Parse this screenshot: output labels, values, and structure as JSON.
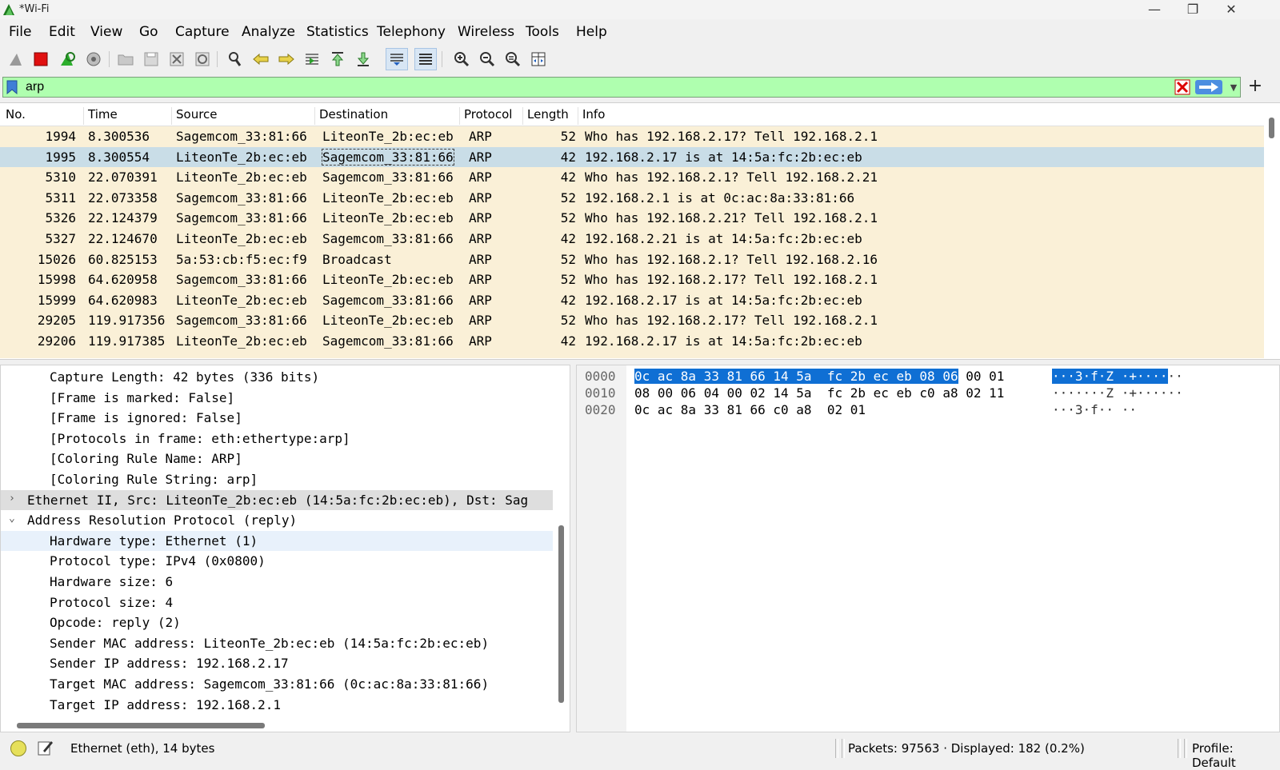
{
  "window": {
    "title": "*Wi-Fi",
    "minimize_label": "—",
    "restore_label": "❐",
    "close_label": "✕"
  },
  "menu": [
    "File",
    "Edit",
    "View",
    "Go",
    "Capture",
    "Analyze",
    "Statistics",
    "Telephony",
    "Wireless",
    "Tools",
    "Help"
  ],
  "filter": {
    "value": "arp",
    "add_label": "+"
  },
  "packet_list": {
    "columns": [
      "No.",
      "Time",
      "Source",
      "Destination",
      "Protocol",
      "Length",
      "Info"
    ],
    "rows": [
      [
        "1994",
        "8.300536",
        "Sagemcom_33:81:66",
        "LiteonTe_2b:ec:eb",
        "ARP",
        "52",
        "Who has 192.168.2.17? Tell 192.168.2.1"
      ],
      [
        "1995",
        "8.300554",
        "LiteonTe_2b:ec:eb",
        "Sagemcom_33:81:66",
        "ARP",
        "42",
        "192.168.2.17 is at 14:5a:fc:2b:ec:eb"
      ],
      [
        "5310",
        "22.070391",
        "LiteonTe_2b:ec:eb",
        "Sagemcom_33:81:66",
        "ARP",
        "42",
        "Who has 192.168.2.1? Tell 192.168.2.21"
      ],
      [
        "5311",
        "22.073358",
        "Sagemcom_33:81:66",
        "LiteonTe_2b:ec:eb",
        "ARP",
        "52",
        "192.168.2.1 is at 0c:ac:8a:33:81:66"
      ],
      [
        "5326",
        "22.124379",
        "Sagemcom_33:81:66",
        "LiteonTe_2b:ec:eb",
        "ARP",
        "52",
        "Who has 192.168.2.21? Tell 192.168.2.1"
      ],
      [
        "5327",
        "22.124670",
        "LiteonTe_2b:ec:eb",
        "Sagemcom_33:81:66",
        "ARP",
        "42",
        "192.168.2.21 is at 14:5a:fc:2b:ec:eb"
      ],
      [
        "15026",
        "60.825153",
        "5a:53:cb:f5:ec:f9",
        "Broadcast",
        "ARP",
        "52",
        "Who has 192.168.2.1? Tell 192.168.2.16"
      ],
      [
        "15998",
        "64.620958",
        "Sagemcom_33:81:66",
        "LiteonTe_2b:ec:eb",
        "ARP",
        "52",
        "Who has 192.168.2.17? Tell 192.168.2.1"
      ],
      [
        "15999",
        "64.620983",
        "LiteonTe_2b:ec:eb",
        "Sagemcom_33:81:66",
        "ARP",
        "42",
        "192.168.2.17 is at 14:5a:fc:2b:ec:eb"
      ],
      [
        "29205",
        "119.917356",
        "Sagemcom_33:81:66",
        "LiteonTe_2b:ec:eb",
        "ARP",
        "52",
        "Who has 192.168.2.17? Tell 192.168.2.1"
      ],
      [
        "29206",
        "119.917385",
        "LiteonTe_2b:ec:eb",
        "Sagemcom_33:81:66",
        "ARP",
        "42",
        "192.168.2.17 is at 14:5a:fc:2b:ec:eb"
      ]
    ],
    "selected_index": 1,
    "row_color": "#faf0d7",
    "selected_color": "#c9dde7"
  },
  "details": [
    {
      "text": "Capture Length: 42 bytes (336 bits)",
      "level": 1
    },
    {
      "text": "[Frame is marked: False]",
      "level": 1
    },
    {
      "text": "[Frame is ignored: False]",
      "level": 1
    },
    {
      "text": "[Protocols in frame: eth:ethertype:arp]",
      "level": 1
    },
    {
      "text": "[Coloring Rule Name: ARP]",
      "level": 1
    },
    {
      "text": "[Coloring Rule String: arp]",
      "level": 1
    },
    {
      "text": "Ethernet II, Src: LiteonTe_2b:ec:eb (14:5a:fc:2b:ec:eb), Dst: Sag",
      "level": 0,
      "arrow": "›"
    },
    {
      "text": "Address Resolution Protocol (reply)",
      "level": 0,
      "arrow": "⌄"
    },
    {
      "text": "Hardware type: Ethernet (1)",
      "level": 1
    },
    {
      "text": "Protocol type: IPv4 (0x0800)",
      "level": 1
    },
    {
      "text": "Hardware size: 6",
      "level": 1
    },
    {
      "text": "Protocol size: 4",
      "level": 1
    },
    {
      "text": "Opcode: reply (2)",
      "level": 1
    },
    {
      "text": "Sender MAC address: LiteonTe_2b:ec:eb (14:5a:fc:2b:ec:eb)",
      "level": 1
    },
    {
      "text": "Sender IP address: 192.168.2.17",
      "level": 1
    },
    {
      "text": "Target MAC address: Sagemcom_33:81:66 (0c:ac:8a:33:81:66)",
      "level": 1
    },
    {
      "text": "Target IP address: 192.168.2.1",
      "level": 1
    }
  ],
  "bytes": [
    {
      "offset": "0000",
      "hex_hl": "0c ac 8a 33 81 66 14 5a  fc 2b ec eb 08 06",
      "hex_rest": " 00 01",
      "ascii_hl": "···3·f·Z ·+····",
      "ascii_rest": "··"
    },
    {
      "offset": "0010",
      "hex_hl": "",
      "hex_rest": "08 00 06 04 00 02 14 5a  fc 2b ec eb c0 a8 02 11",
      "ascii_hl": "",
      "ascii_rest": "·······Z ·+······"
    },
    {
      "offset": "0020",
      "hex_hl": "",
      "hex_rest": "0c ac 8a 33 81 66 c0 a8  02 01",
      "ascii_hl": "",
      "ascii_rest": "···3·f·· ··"
    }
  ],
  "status": {
    "text": "Ethernet (eth), 14 bytes",
    "packets": "Packets: 97563 · Displayed: 182 (0.2%)",
    "profile": "Profile: Default"
  },
  "icons": [
    "shark-fin-start-icon",
    "stop-capture-icon",
    "restart-capture-icon",
    "capture-options-icon",
    "open-file-icon",
    "save-file-icon",
    "close-file-icon",
    "reload-file-icon",
    "find-packet-icon",
    "go-back-icon",
    "go-forward-icon",
    "go-to-packet-icon",
    "go-first-icon",
    "go-last-icon",
    "autoscroll-icon",
    "colorize-icon",
    "zoom-in-icon",
    "zoom-out-icon",
    "zoom-normal-icon",
    "resize-columns-icon"
  ]
}
